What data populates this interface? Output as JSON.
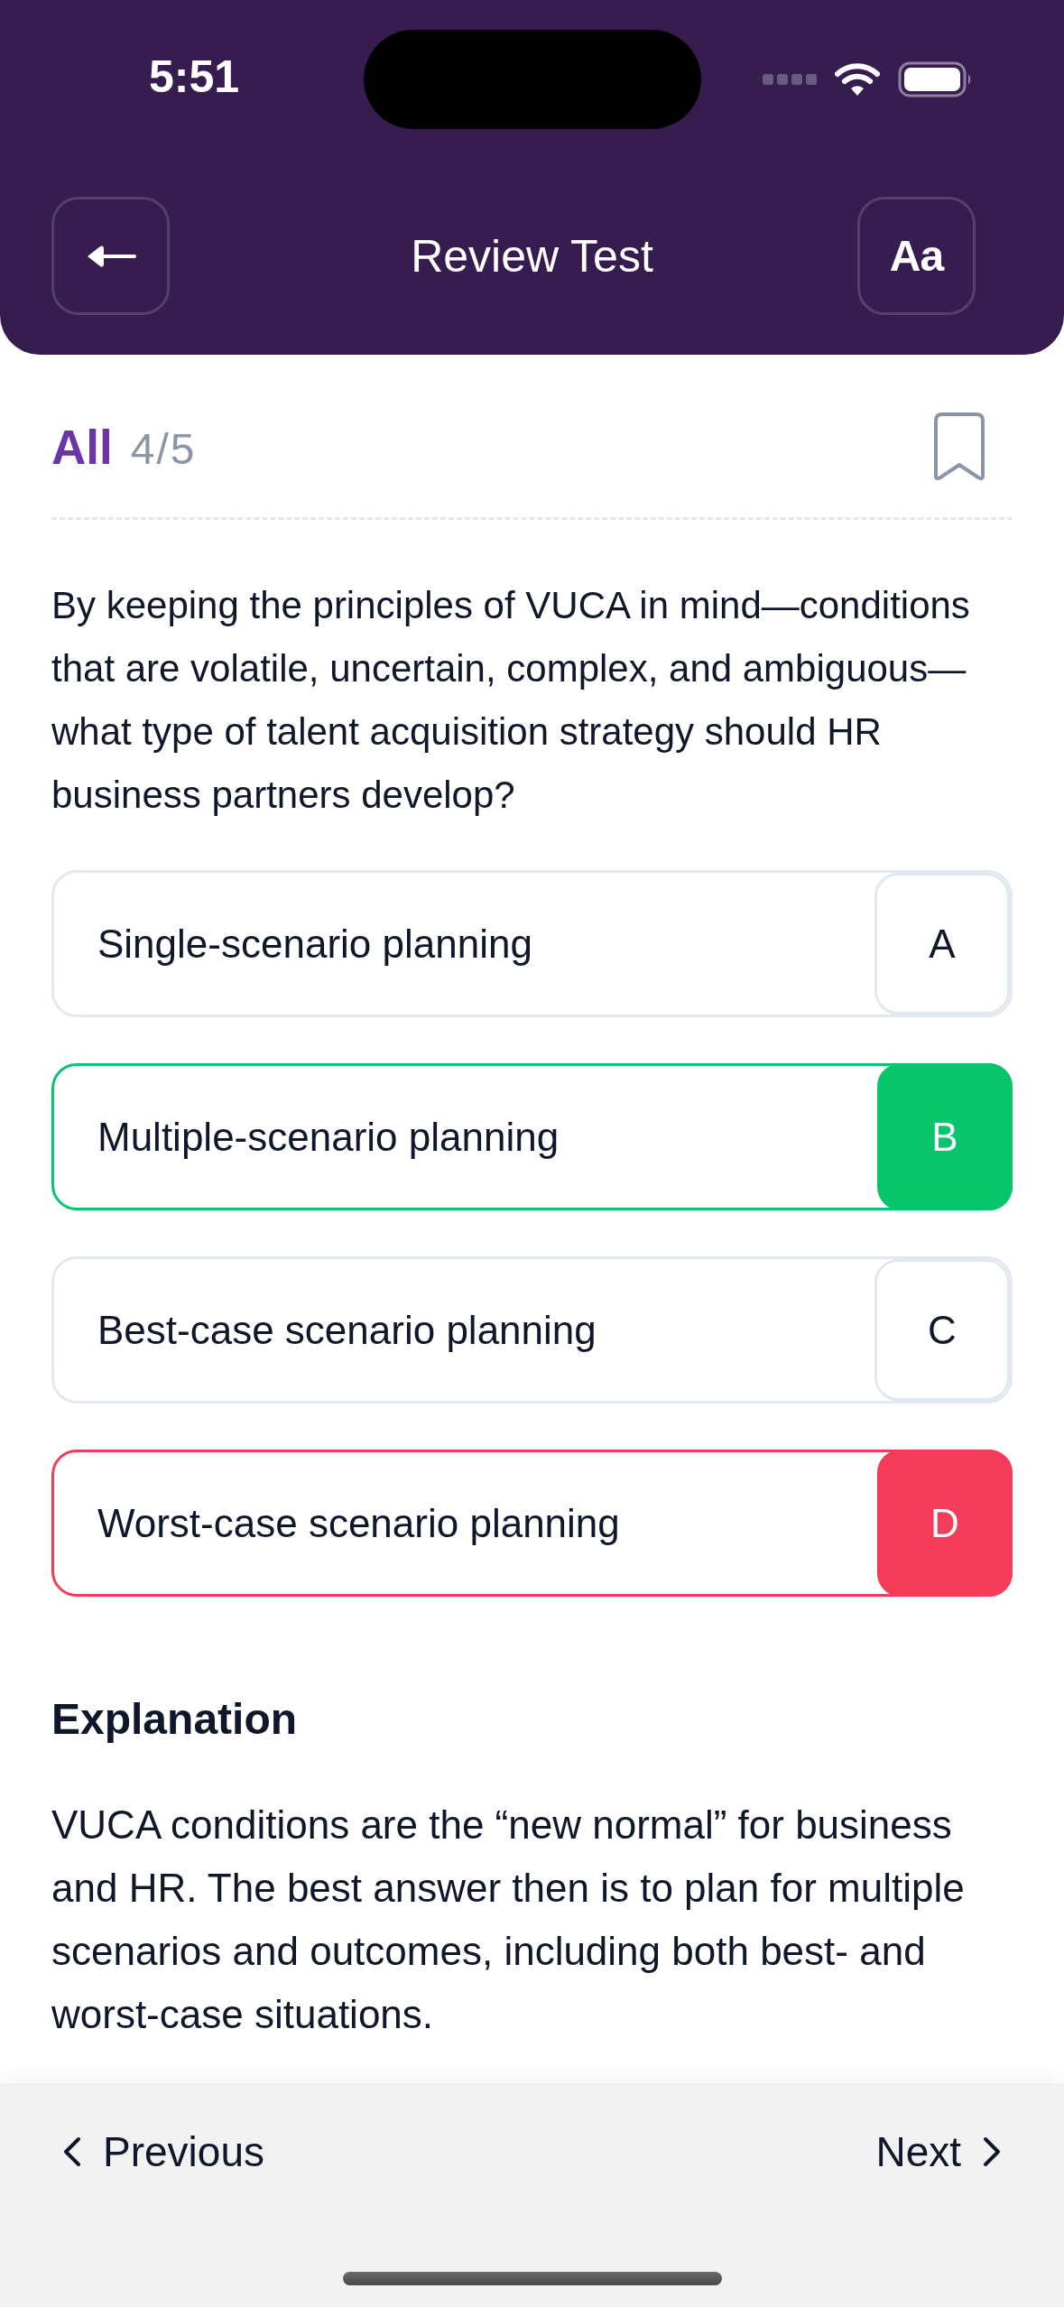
{
  "status_bar": {
    "time": "5:51"
  },
  "header": {
    "title": "Review Test",
    "text_size_button": "Aa"
  },
  "filter": {
    "label": "All",
    "counter": "4/5",
    "bookmarked": false
  },
  "question": {
    "text": "By keeping the principles of VUCA in mind—conditions that are volatile, uncertain, complex, and ambiguous—what type of talent acquisition strategy should HR business partners develop?",
    "options": [
      {
        "letter": "A",
        "text": "Single-scenario planning",
        "kind": "neutral"
      },
      {
        "letter": "B",
        "text": "Multiple-scenario planning",
        "kind": "correct"
      },
      {
        "letter": "C",
        "text": "Best-case scenario planning",
        "kind": "neutral"
      },
      {
        "letter": "D",
        "text": "Worst-case scenario planning",
        "kind": "incorrect"
      }
    ]
  },
  "explanation": {
    "title": "Explanation",
    "text": "VUCA conditions are the “new normal” for business and HR. The best answer then is to plan for multiple scenarios and outcomes, including both best- and worst-case situations."
  },
  "footer": {
    "previous": "Previous",
    "next": "Next"
  }
}
